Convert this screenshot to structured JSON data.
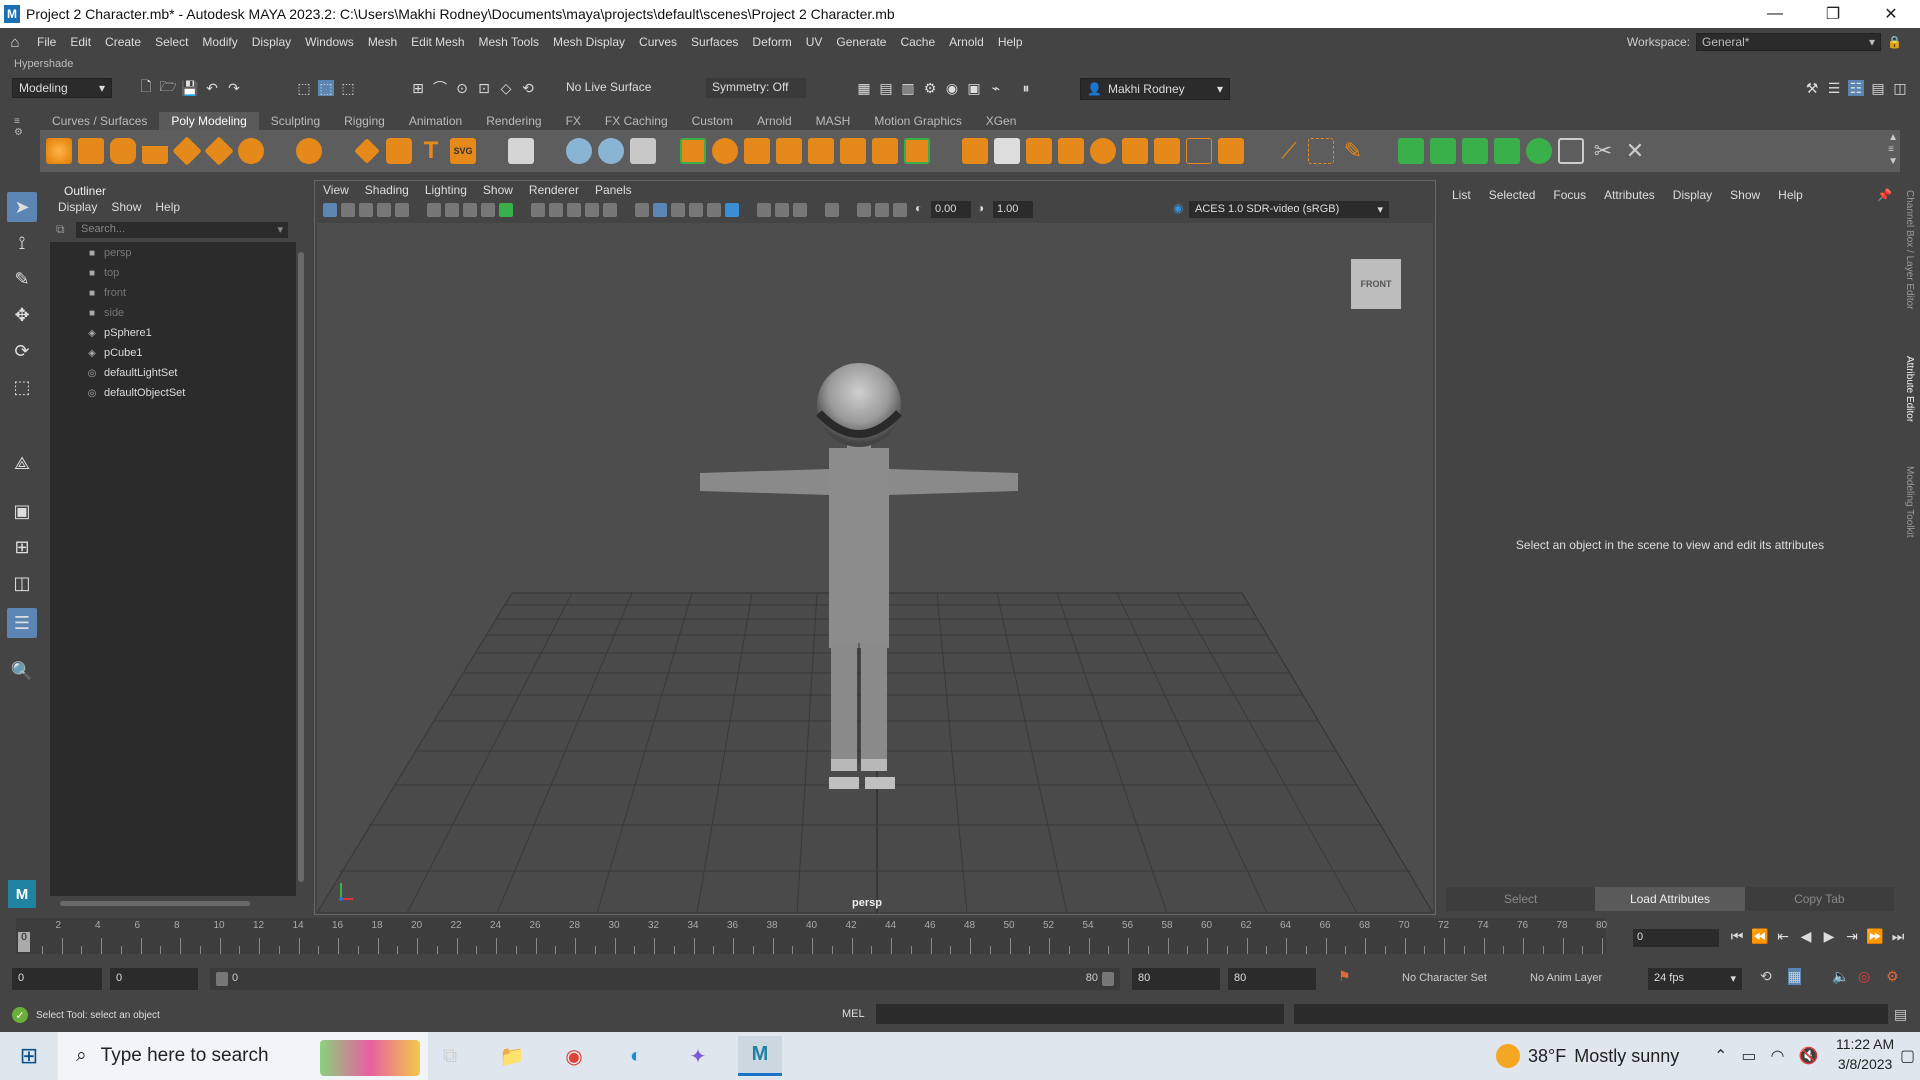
{
  "window": {
    "title": "Project 2 Character.mb* - Autodesk MAYA 2023.2: C:\\Users\\Makhi Rodney\\Documents\\maya\\projects\\default\\scenes\\Project 2 Character.mb",
    "app_icon": "M",
    "minimize": "—",
    "maximize": "❐",
    "close": "✕"
  },
  "menubar": {
    "items": [
      "File",
      "Edit",
      "Create",
      "Select",
      "Modify",
      "Display",
      "Windows",
      "Mesh",
      "Edit Mesh",
      "Mesh Tools",
      "Mesh Display",
      "Curves",
      "Surfaces",
      "Deform",
      "UV",
      "Generate",
      "Cache",
      "Arnold",
      "Help"
    ],
    "workspace_label": "Workspace:",
    "workspace_value": "General*"
  },
  "hypershade_label": "Hypershade",
  "statusline": {
    "mode": "Modeling",
    "live_surface": "No Live Surface",
    "symmetry": "Symmetry: Off",
    "user": "Makhi Rodney"
  },
  "shelf": {
    "tabs": [
      "Curves / Surfaces",
      "Poly Modeling",
      "Sculpting",
      "Rigging",
      "Animation",
      "Rendering",
      "FX",
      "FX Caching",
      "Custom",
      "Arnold",
      "MASH",
      "Motion Graphics",
      "XGen"
    ],
    "active_tab": "Poly Modeling",
    "svg_label": "SVG"
  },
  "outliner": {
    "title": "Outliner",
    "menu": [
      "Display",
      "Show",
      "Help"
    ],
    "search_placeholder": "Search...",
    "items": [
      {
        "label": "persp",
        "icon": "camera-icon",
        "dim": true
      },
      {
        "label": "top",
        "icon": "camera-icon",
        "dim": true
      },
      {
        "label": "front",
        "icon": "camera-icon",
        "dim": true
      },
      {
        "label": "side",
        "icon": "camera-icon",
        "dim": true
      },
      {
        "label": "pSphere1",
        "icon": "transform-icon",
        "dim": false
      },
      {
        "label": "pCube1",
        "icon": "transform-icon",
        "dim": false
      },
      {
        "label": "defaultLightSet",
        "icon": "set-icon",
        "dim": false
      },
      {
        "label": "defaultObjectSet",
        "icon": "set-icon",
        "dim": false
      }
    ]
  },
  "viewport": {
    "menu": [
      "View",
      "Shading",
      "Lighting",
      "Show",
      "Renderer",
      "Panels"
    ],
    "field_a": "0.00",
    "field_b": "1.00",
    "color_space": "ACES 1.0 SDR-video (sRGB)",
    "camera": "persp",
    "viewcube": "FRONT"
  },
  "attribute_editor": {
    "menu": [
      "List",
      "Selected",
      "Focus",
      "Attributes",
      "Display",
      "Show",
      "Help"
    ],
    "message": "Select an object in the scene to view and edit its attributes",
    "buttons": [
      "Select",
      "Load Attributes",
      "Copy Tab"
    ],
    "side_tabs": [
      "Channel Box / Layer Editor",
      "Attribute Editor",
      "Modeling Toolkit"
    ]
  },
  "timeline": {
    "tick_labels": [
      "2",
      "4",
      "6",
      "8",
      "10",
      "12",
      "14",
      "16",
      "18",
      "20",
      "22",
      "24",
      "26",
      "28",
      "30",
      "32",
      "34",
      "36",
      "38",
      "40",
      "42",
      "44",
      "46",
      "48",
      "50",
      "52",
      "54",
      "56",
      "58",
      "60",
      "62",
      "64",
      "66",
      "68",
      "70",
      "72",
      "74",
      "76",
      "78",
      "80"
    ],
    "current": "0",
    "current_frame_field": "0"
  },
  "range": {
    "start": "0",
    "anim_start": "0",
    "slider_start": "0",
    "slider_end": "80",
    "anim_end": "80",
    "end": "80",
    "character_set": "No Character Set",
    "anim_layer": "No Anim Layer",
    "fps": "24 fps"
  },
  "command": {
    "help": "Select Tool: select an object",
    "mel": "MEL"
  },
  "taskbar": {
    "search": "Type here to search",
    "temp": "38°F",
    "weather": "Mostly sunny",
    "time": "11:22 AM",
    "date": "3/8/2023"
  }
}
